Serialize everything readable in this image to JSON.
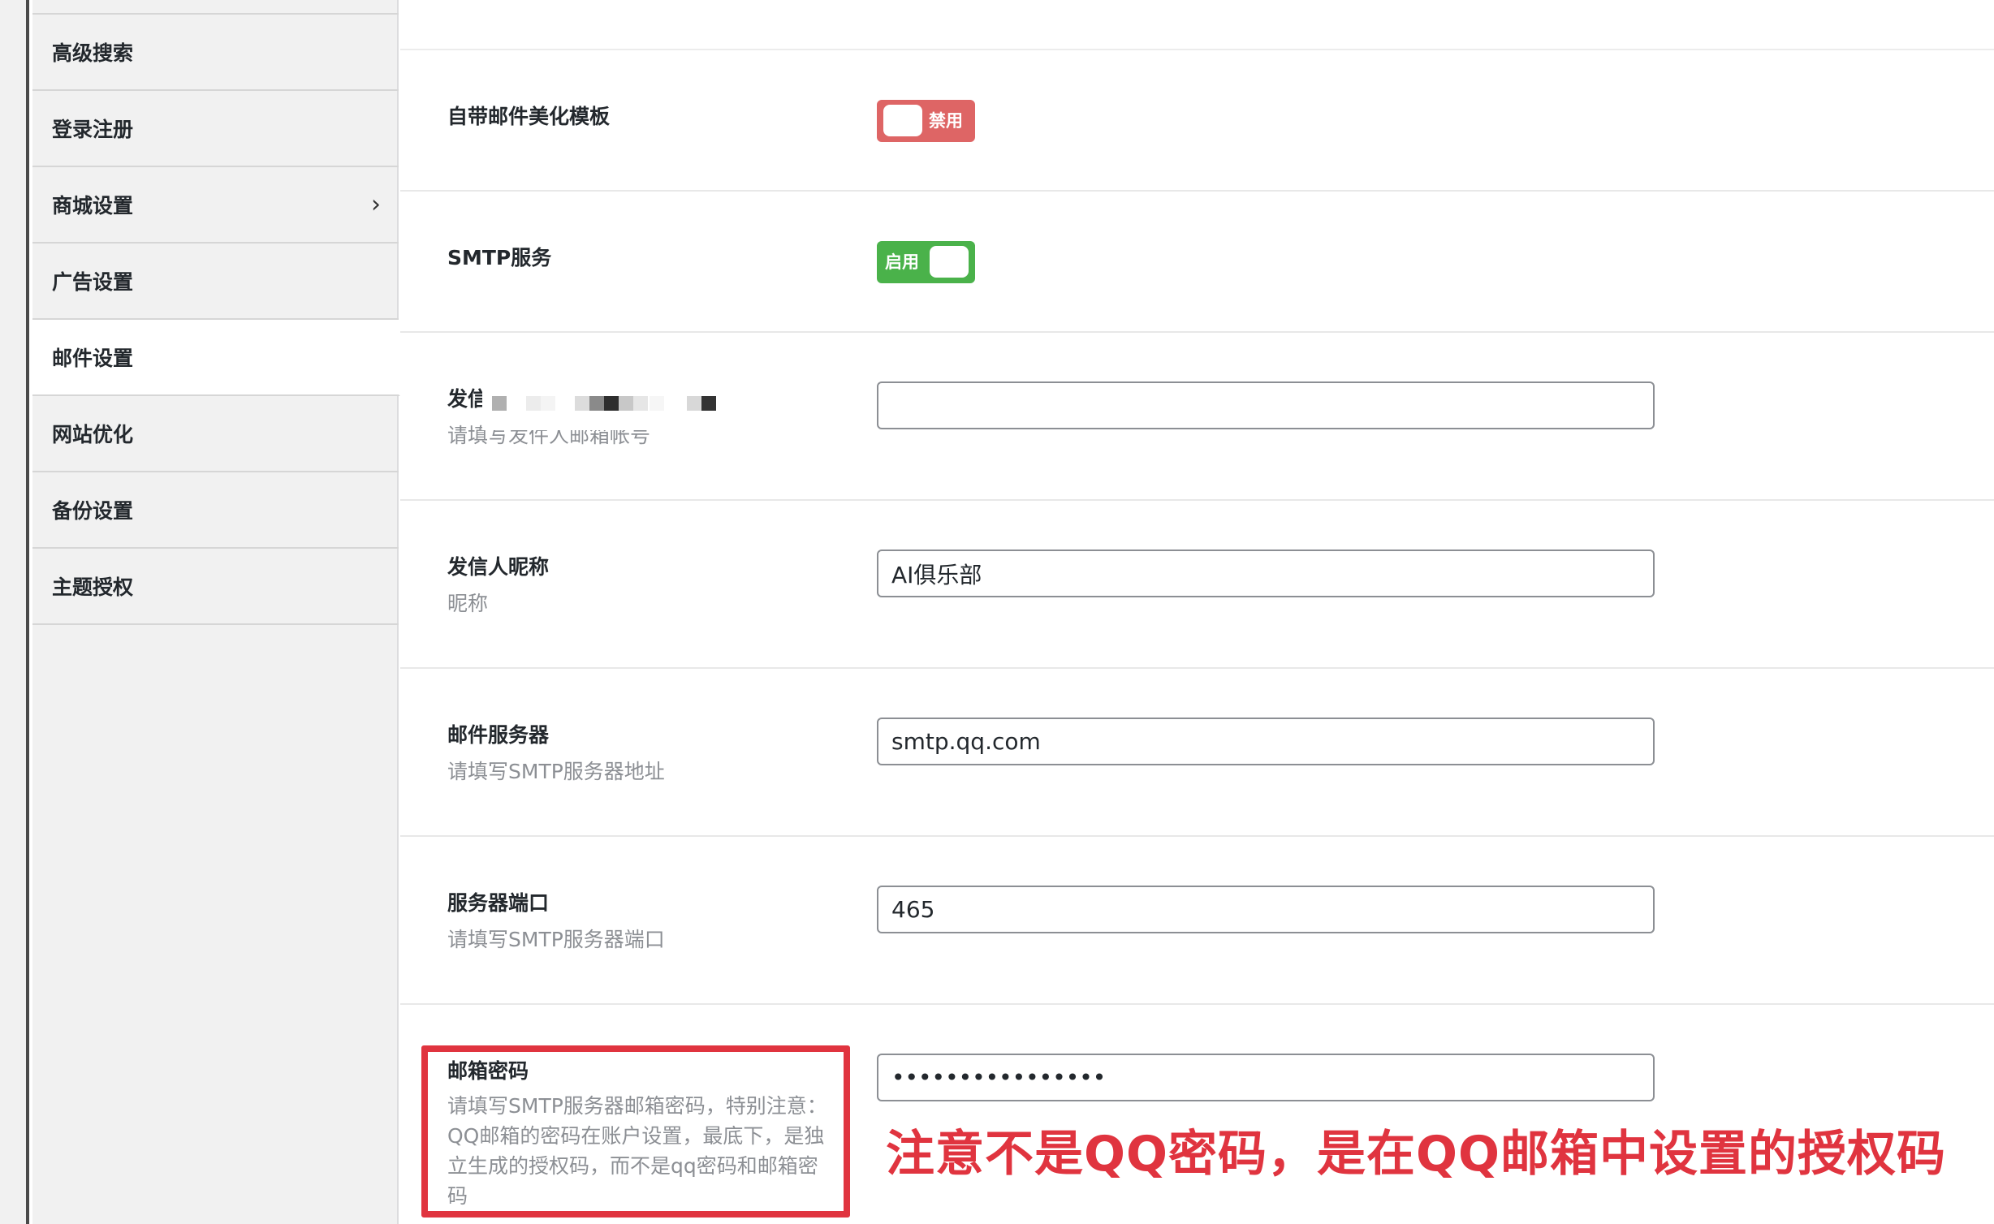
{
  "sidebar": {
    "items": [
      {
        "label": "高级搜索",
        "active": false,
        "has_children": false
      },
      {
        "label": "登录注册",
        "active": false,
        "has_children": false
      },
      {
        "label": "商城设置",
        "active": false,
        "has_children": true
      },
      {
        "label": "广告设置",
        "active": false,
        "has_children": false
      },
      {
        "label": "邮件设置",
        "active": true,
        "has_children": false
      },
      {
        "label": "网站优化",
        "active": false,
        "has_children": false
      },
      {
        "label": "备份设置",
        "active": false,
        "has_children": false
      },
      {
        "label": "主题授权",
        "active": false,
        "has_children": false
      }
    ],
    "chevron_icon": "chevron-right-icon"
  },
  "settings": {
    "template": {
      "label": "自带邮件美化模板",
      "state": "禁用",
      "enabled": false,
      "color": "#de6565"
    },
    "smtp": {
      "label": "SMTP服务",
      "state": "启用",
      "enabled": true,
      "color": "#4ab24a"
    },
    "sender_email": {
      "label": "发信邮箱",
      "desc": "请填写发件人邮箱帐号",
      "value": "",
      "redacted": true
    },
    "sender_name": {
      "label": "发信人昵称",
      "desc": "昵称",
      "value": "AI俱乐部"
    },
    "server": {
      "label": "邮件服务器",
      "desc": "请填写SMTP服务器地址",
      "value": "smtp.qq.com"
    },
    "port": {
      "label": "服务器端口",
      "desc": "请填写SMTP服务器端口",
      "value": "465"
    },
    "password": {
      "label": "邮箱密码",
      "desc_lines": [
        "请填写SMTP服务器邮箱密码，特别注意：",
        "QQ邮箱的密码在账户设置，最底下，是独",
        "立生成的授权码，而不是qq密码和邮箱密",
        "码"
      ],
      "value": "••••••••••••••••"
    }
  },
  "annotation": {
    "text": "注意不是QQ密码，是在QQ邮箱中设置的授权码",
    "color": "#e0343f"
  }
}
